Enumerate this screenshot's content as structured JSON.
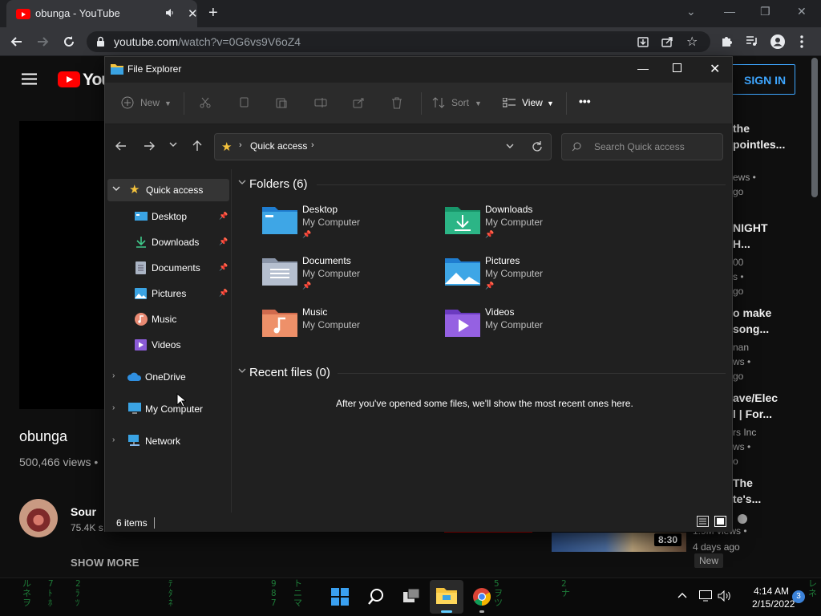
{
  "browser": {
    "tab": {
      "title": "obunga - YouTube"
    },
    "url_host": "youtube.com",
    "url_path": "/watch?v=0G6vs9V6oZ4"
  },
  "youtube": {
    "logo_text": "You",
    "sign_in": "SIGN IN",
    "video": {
      "title": "obunga",
      "views": "500,466 views •"
    },
    "channel": {
      "name": "Sour",
      "subs": "75.4K s"
    },
    "show_more": "SHOW MORE",
    "sidebar": [
      {
        "t1": "the",
        "t2": "pointles...",
        "s1": "ews •",
        "s2": "go"
      },
      {
        "t1": "NIGHT",
        "t2": "H...",
        "s1": "00",
        "s2": "s •",
        "s3": "go"
      },
      {
        "t1": "o make",
        "t2": "song...",
        "s1": "nan",
        "s2": "ws •",
        "s3": "go"
      },
      {
        "t1": "ave/Elec",
        "t2": "l | For...",
        "s1": "rs Inc",
        "s2": "ws •",
        "s3": "o"
      },
      {
        "t1": "The",
        "t2": "te's..."
      }
    ],
    "last_item": {
      "views": "1.9M views •",
      "age": "4 days ago",
      "badge": "New",
      "duration": "8:30"
    }
  },
  "explorer": {
    "title": "File Explorer",
    "toolbar": {
      "new": "New",
      "sort": "Sort",
      "view": "View",
      "more": "•••"
    },
    "address": "Quick access",
    "search_placeholder": "Search Quick access",
    "nav": {
      "quick_access": "Quick access",
      "items": [
        "Desktop",
        "Downloads",
        "Documents",
        "Pictures",
        "Music",
        "Videos"
      ],
      "onedrive": "OneDrive",
      "computer": "My Computer",
      "network": "Network"
    },
    "folders_header": "Folders (6)",
    "folders": [
      {
        "name": "Desktop",
        "location": "My Computer",
        "pinned": true
      },
      {
        "name": "Downloads",
        "location": "My Computer",
        "pinned": true
      },
      {
        "name": "Documents",
        "location": "My Computer",
        "pinned": true
      },
      {
        "name": "Pictures",
        "location": "My Computer",
        "pinned": true
      },
      {
        "name": "Music",
        "location": "My Computer",
        "pinned": false
      },
      {
        "name": "Videos",
        "location": "My Computer",
        "pinned": false
      }
    ],
    "recent_header": "Recent files (0)",
    "recent_empty": "After you've opened some files, we'll show the most recent ones here.",
    "status": "6 items"
  },
  "taskbar": {
    "time": "4:14 AM",
    "date": "2/15/2022",
    "notifications": "3"
  },
  "colors": {
    "youtube_red": "#ff0000",
    "link_blue": "#3ea6ff",
    "folder_blue": "#3ea6e6",
    "taskbar_matrix": "#1e7a38"
  }
}
